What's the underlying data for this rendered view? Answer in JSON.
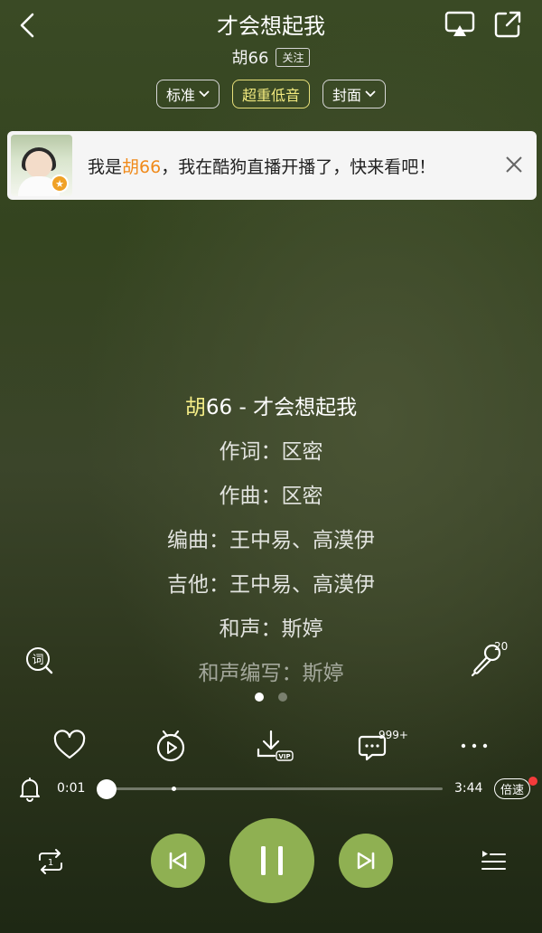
{
  "header": {
    "title": "才会想起我",
    "artist": "胡66",
    "follow_label": "关注",
    "chips": [
      {
        "label": "标准",
        "has_dropdown": true,
        "active": false
      },
      {
        "label": "超重低音",
        "has_dropdown": false,
        "active": true
      },
      {
        "label": "封面",
        "has_dropdown": true,
        "active": false
      }
    ]
  },
  "banner": {
    "text_before": "我是",
    "text_highlight": "胡66",
    "text_after": "，我在酷狗直播开播了，快来看吧！",
    "highlight_color": "#f08a1a",
    "badge_icon": "star-icon"
  },
  "lyrics": {
    "lines": [
      {
        "text_kara": "胡",
        "text": "66 - 才会想起我",
        "current": true
      },
      {
        "text": "作词：区密"
      },
      {
        "text": "作曲：区密"
      },
      {
        "text": "编曲：王中易、高漠伊"
      },
      {
        "text": "吉他：王中易、高漠伊"
      },
      {
        "text": "和声：斯婷"
      },
      {
        "text": "和声编写：斯婷",
        "fade": true
      }
    ],
    "karaoke_color": "#f3ec86"
  },
  "mic": {
    "count": "20"
  },
  "pager": {
    "count": 2,
    "active_index": 0
  },
  "actions": {
    "comment_count": "999+",
    "items": [
      "heart-icon",
      "video-icon",
      "download-vip-icon",
      "comment-icon",
      "more-icon"
    ]
  },
  "progress": {
    "current_time": "0:01",
    "total_time": "3:44",
    "played_fraction": 0.004,
    "speed_label": "倍速"
  },
  "colors": {
    "accent": "#8fb052",
    "badge_dot": "#f33b3b"
  }
}
